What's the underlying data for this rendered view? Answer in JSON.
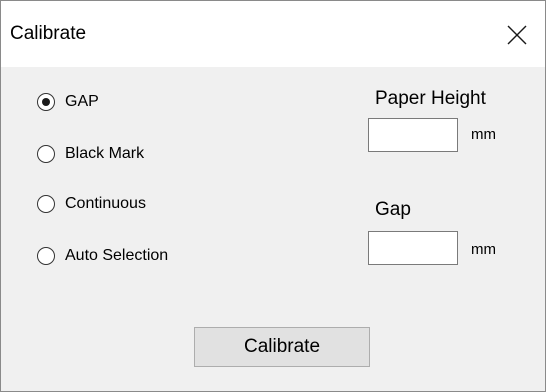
{
  "window": {
    "title": "Calibrate"
  },
  "media_type": {
    "options": [
      {
        "label": "GAP",
        "checked": true
      },
      {
        "label": "Black Mark",
        "checked": false
      },
      {
        "label": "Continuous",
        "checked": false
      },
      {
        "label": "Auto Selection",
        "checked": false
      }
    ]
  },
  "paper_height": {
    "label": "Paper Height",
    "value": "",
    "unit": "mm"
  },
  "gap": {
    "label": "Gap",
    "value": "",
    "unit": "mm"
  },
  "actions": {
    "calibrate_label": "Calibrate"
  },
  "icons": {
    "close": "close-icon"
  }
}
